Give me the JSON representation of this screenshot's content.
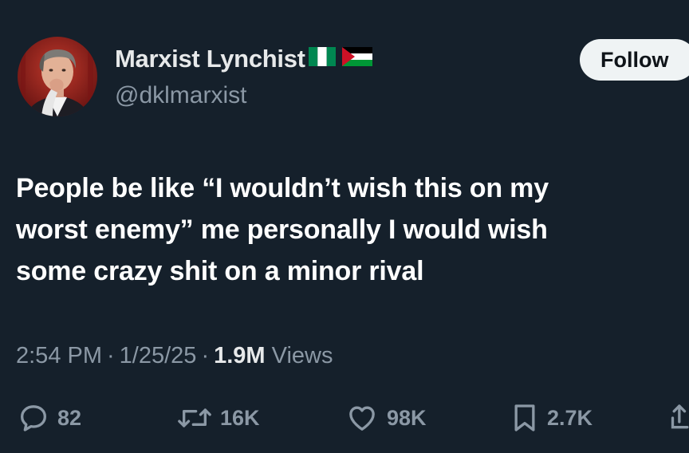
{
  "author": {
    "display_name": "Marxist Lynchist",
    "handle": "@dklmarxist",
    "avatar_icon": "profile-photo",
    "flags": [
      "nigeria-flag-icon",
      "palestine-flag-icon"
    ]
  },
  "follow_button": {
    "label": "Follow"
  },
  "tweet": {
    "lines": [
      "People be like “I wouldn’t wish this on my",
      "worst enemy” me personally I would wish",
      "some crazy shit on a minor rival"
    ]
  },
  "meta": {
    "time": "2:54 PM",
    "date": "1/25/25",
    "views_count": "1.9M",
    "views_label": "Views",
    "separator": "·"
  },
  "actions": {
    "replies": "82",
    "reposts": "16K",
    "likes": "98K",
    "bookmarks": "2.7K"
  },
  "colors": {
    "background": "#15202b",
    "primary_text": "#e7e9ea",
    "secondary_text": "#8b98a5",
    "follow_bg": "#eff3f4"
  }
}
